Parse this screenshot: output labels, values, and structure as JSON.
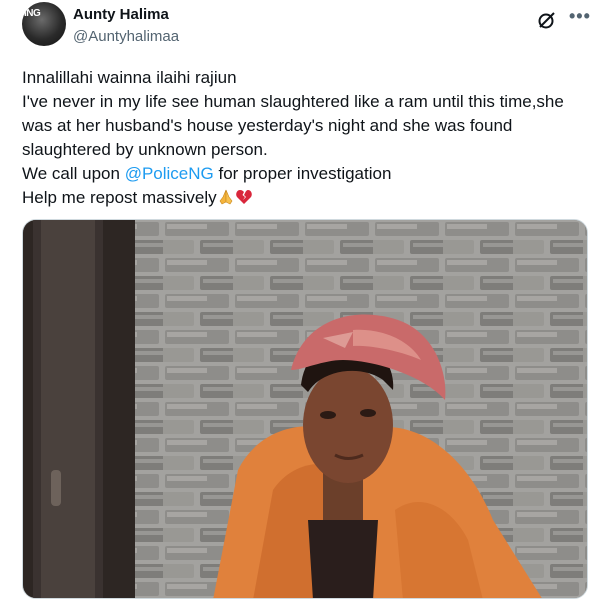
{
  "author": {
    "display_name": "Aunty Halima",
    "handle": "@Auntyhalimaa",
    "avatar_icon": "profile-photo",
    "watermark": "ING"
  },
  "header_icons": {
    "grok": "grok-icon",
    "more": "more-icon",
    "more_glyph": "•••"
  },
  "tweet": {
    "line1": "Innalillahi wainna ilaihi rajiun",
    "line2": "I've never in my life see human slaughtered like a ram until this time,she",
    "line3": "was at her husband's house yesterday's night and she was found",
    "line4": "slaughtered by unknown person.",
    "line5_prefix": "We call upon ",
    "mention": "@PoliceNG",
    "line5_suffix": " for proper investigation",
    "line6": "Help me repost massively"
  },
  "colors": {
    "mention": "#1d9bf0",
    "secondary_text": "#536471"
  },
  "media": {
    "kind": "photo",
    "subject": "young woman in orange hijab against a grey brick wall"
  }
}
